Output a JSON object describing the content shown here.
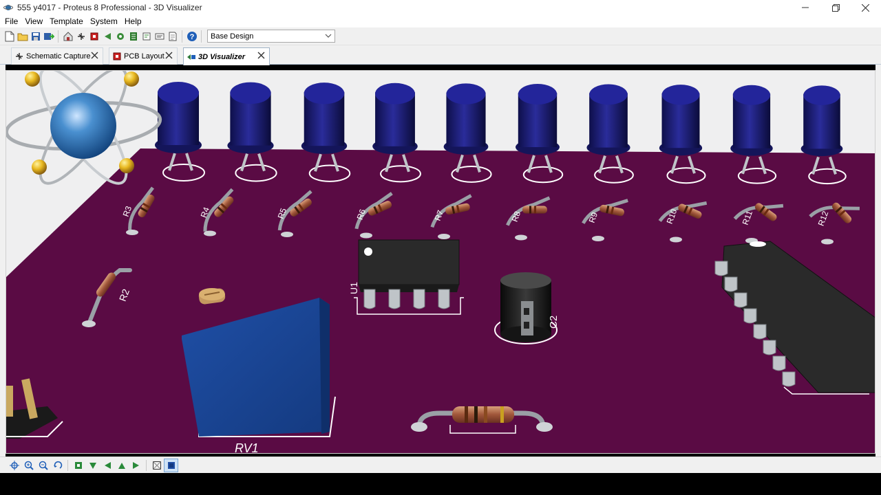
{
  "window": {
    "title": "555 y4017 - Proteus 8 Professional - 3D Visualizer"
  },
  "menu": [
    "File",
    "View",
    "Template",
    "System",
    "Help"
  ],
  "toolbar": {
    "variant_select": "Base Design",
    "icons": [
      "new-file-icon",
      "open-folder-icon",
      "save-icon",
      "import-icon",
      "home-icon",
      "schematic-icon",
      "pcb-icon",
      "back-icon",
      "gerber-icon",
      "bom-icon",
      "design-explorer-icon",
      "netlist-icon",
      "notes-icon",
      "help-icon"
    ]
  },
  "tabs": [
    {
      "label": "Schematic Capture",
      "active": false
    },
    {
      "label": "PCB Layout",
      "active": false
    },
    {
      "label": "3D Visualizer",
      "active": true
    }
  ],
  "board": {
    "pcb_color": "#5a0b44",
    "led_color": "#1c1d78",
    "silkscreen_color": "#ffffff",
    "labels": {
      "resistors_top": [
        "R3",
        "R4",
        "R5",
        "R6",
        "R7",
        "R8",
        "R9",
        "R10",
        "R11",
        "R12"
      ],
      "r2": "R2",
      "u1": "U1",
      "c2": "C2",
      "rv1": "RV1"
    }
  },
  "bottom_toolbar": {
    "icons": [
      "pan-icon",
      "zoom-in-icon",
      "zoom-out-icon",
      "rotate-icon",
      "top-view-icon",
      "bottom-view-icon",
      "left-view-icon",
      "front-view-icon",
      "right-view-icon",
      "wireframe-icon",
      "solid-view-icon"
    ]
  }
}
